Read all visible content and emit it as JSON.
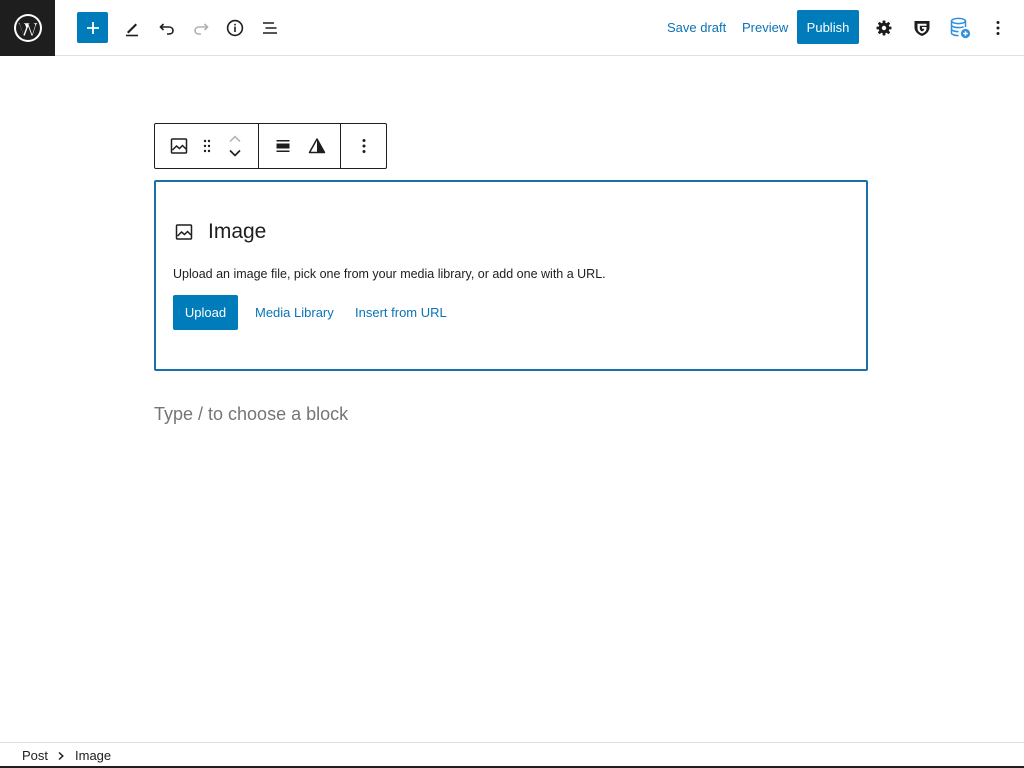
{
  "header": {
    "logo_icon": "wordpress-logo-icon",
    "add_icon": "plus-icon",
    "tools_icon": "pencil-icon",
    "undo_icon": "undo-icon",
    "redo_icon": "redo-icon",
    "details_icon": "info-icon",
    "list_view_icon": "list-view-icon",
    "save_draft_label": "Save draft",
    "preview_label": "Preview",
    "publish_label": "Publish",
    "settings_icon": "gear-icon",
    "plugin_icon": "shield-g-icon",
    "database_icon": "database-icon",
    "options_icon": "vertical-ellipsis-icon"
  },
  "block_toolbar": {
    "block_type_icon": "image-icon",
    "drag_icon": "drag-handle-icon",
    "move_up_icon": "chevron-up-icon",
    "move_down_icon": "chevron-down-icon",
    "align_icon": "align-center-icon",
    "duotone_icon": "filter-triangle-icon",
    "more_options_icon": "vertical-ellipsis-icon"
  },
  "image_block": {
    "icon": "image-icon",
    "title": "Image",
    "instructions": "Upload an image file, pick one from your media library, or add one with a URL.",
    "upload_label": "Upload",
    "media_library_label": "Media Library",
    "insert_url_label": "Insert from URL"
  },
  "appender": {
    "placeholder": "Type / to choose a block"
  },
  "breadcrumb": {
    "items": [
      "Post",
      "Image"
    ],
    "separator_icon": "chevron-right-icon"
  },
  "colors": {
    "accent": "#007cba",
    "link": "#0a74b5",
    "dark": "#1e1e1e",
    "muted": "#757575"
  }
}
